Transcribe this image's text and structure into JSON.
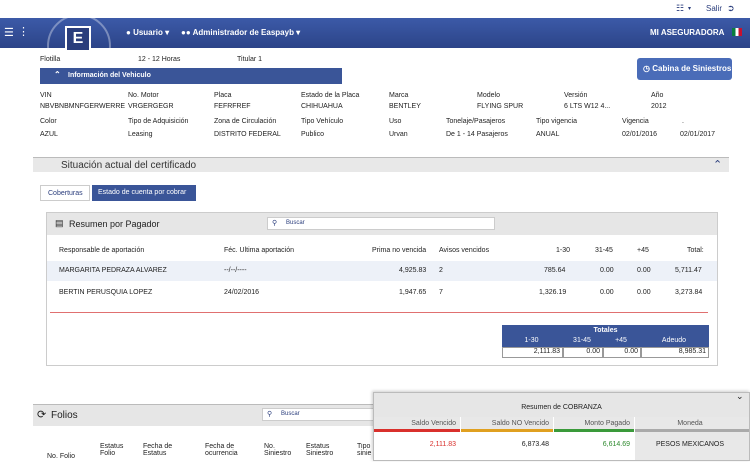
{
  "topbar": {
    "salir": "Salir"
  },
  "nav": {
    "usuario": "Usuario",
    "admin": "Administrador de Easpayb",
    "aseguradora": "MI ASEGURADORA"
  },
  "flotilla": {
    "label": "Flotilla",
    "horas": "12 - 12 Horas",
    "titular": "Titular 1"
  },
  "vehiculo": {
    "title": "Información del Vehiculo",
    "headers1": [
      "VIN",
      "No. Motor",
      "Placa",
      "Estado de la Placa",
      "Marca",
      "Modelo",
      "Versión",
      "Año"
    ],
    "values1": [
      "NBVBNBMNFGERWERRE",
      "VRGERGEGR",
      "FEFRFREF",
      "CHIHUAHUA",
      "BENTLEY",
      "FLYING SPUR",
      "6 LTS W12 4...",
      "2012"
    ],
    "headers2": [
      "Color",
      "Tipo de Adquisición",
      "Zona de Circulación",
      "Tipo Vehículo",
      "Uso",
      "Tonelaje/Pasajeros",
      "Tipo vigencia",
      "Vigencia",
      "."
    ],
    "values2": [
      "AZUL",
      "Leasing",
      "DISTRITO FEDERAL",
      "Publico",
      "Urvan",
      "De 1 - 14 Pasajeros",
      "ANUAL",
      "02/01/2016",
      "02/01/2017"
    ]
  },
  "cabina": "Cabina de Siniestros",
  "situacion": "Situación actual del certificado",
  "tabs": [
    "Coberturas",
    "Estado de cuenta por cobrar"
  ],
  "resumen": {
    "title": "Resumen por Pagador",
    "search_placeholder": "Buscar",
    "headers": [
      "Responsable de aportación",
      "Féc. Ultima aportación",
      "Prima no vencida",
      "Avisos vencidos",
      "1-30",
      "31-45",
      "+45",
      "Total:"
    ],
    "rows": [
      [
        "MARGARITA PEDRAZA ALVAREZ",
        "--/--/----",
        "4,925.83",
        "2",
        "785.64",
        "0.00",
        "0.00",
        "5,711.47"
      ],
      [
        "BERTIN PERUSQUIA LOPEZ",
        "24/02/2016",
        "1,947.65",
        "7",
        "1,326.19",
        "0.00",
        "0.00",
        "3,273.84"
      ]
    ]
  },
  "totales": {
    "title": "Totales",
    "headers": [
      "1-30",
      "31-45",
      "+45",
      "Adeudo"
    ],
    "values": [
      "2,111.83",
      "0.00",
      "0.00",
      "8,985.31"
    ]
  },
  "folios": {
    "title": "Folios",
    "search_placeholder": "Buscar",
    "headers": [
      "No. Folio",
      "Estatus Folio",
      "Fecha de Estatus",
      "Fecha de ocurrencia",
      "No. Siniestro",
      "Estatus Siniestro",
      "Tipo sinie"
    ]
  },
  "cobranza": {
    "title": "Resumen de COBRANZA",
    "headers": [
      "Saldo Vencido",
      "Saldo NO Vencido",
      "Monto Pagado",
      "Moneda"
    ],
    "values": [
      "2,111.83",
      "6,873.48",
      "6,614.69",
      "PESOS MEXICANOS"
    ],
    "colors": [
      "#d9302c",
      "#e0a020",
      "#3a9a3a",
      "#aaaaaa"
    ]
  }
}
